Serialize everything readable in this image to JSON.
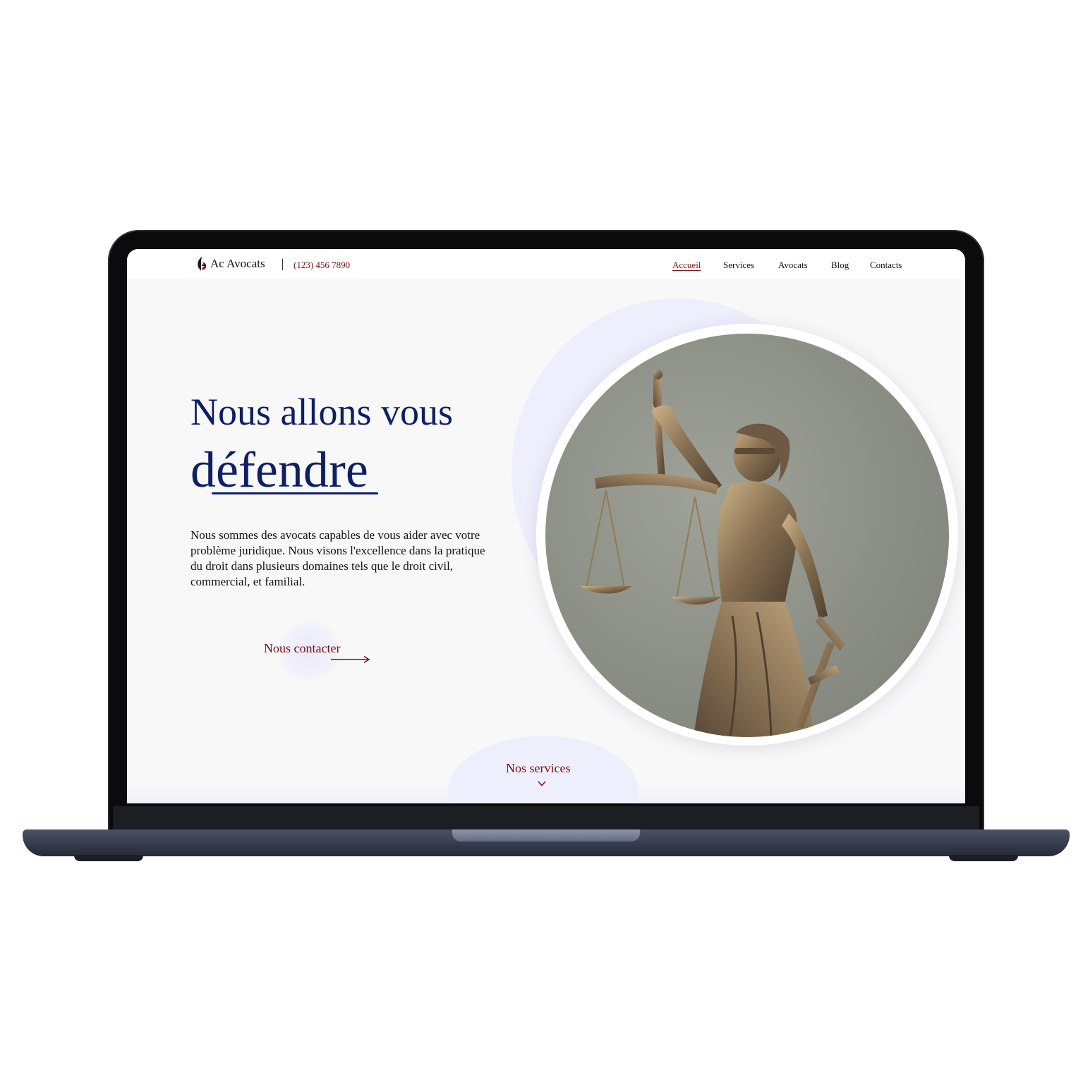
{
  "header": {
    "brand": "Ac Avocats",
    "phone": "(123) 456 7890",
    "nav": [
      "Accueil",
      "Services",
      "Avocats",
      "Blog",
      "Contacts"
    ],
    "active_nav": "Accueil"
  },
  "hero": {
    "title_line1": "Nous allons vous",
    "title_line2": "défendre",
    "intro": "Nous sommes des avocats capables de vous aider avec votre problème juridique. Nous visons l'excellence dans la pratique du droit dans plusieurs domaines tels que le droit civil, commercial, et familial.",
    "cta_label": "Nous contacter",
    "image_subject": "lady-justice-statue"
  },
  "services_link": {
    "label": "Nos services"
  },
  "colors": {
    "navy": "#0e1f64",
    "accent_red": "#7a0f0f",
    "blob": "#eeeffd",
    "page_bg": "#f8f8f9"
  }
}
